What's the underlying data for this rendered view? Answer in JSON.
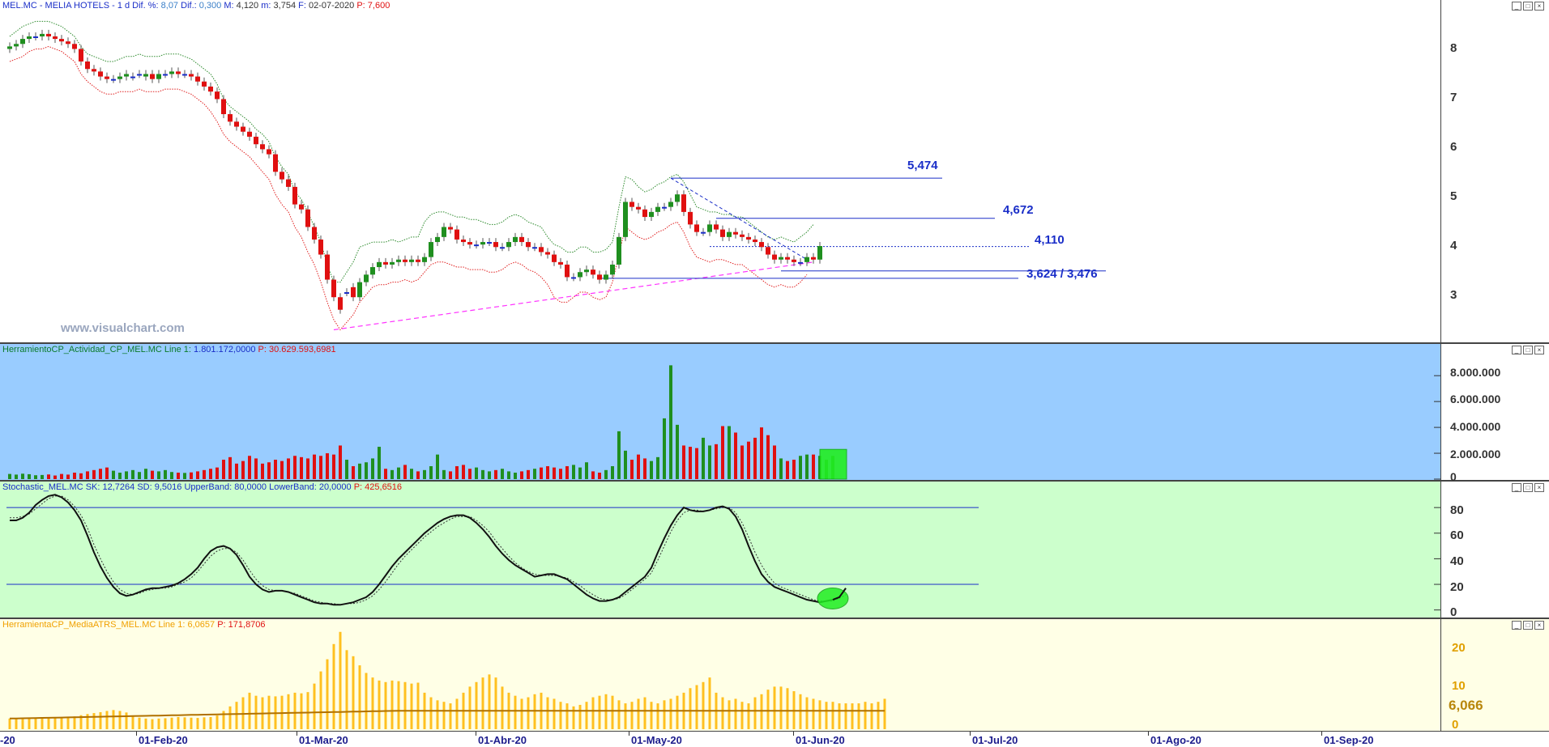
{
  "price_panel": {
    "header": {
      "symbol_text": "MEL.MC - MELIA HOTELS -",
      "period_text": "1 d",
      "dif_pct_label": "Dif. %:",
      "dif_pct_value": "8,07",
      "dif_label": "Dif.:",
      "dif_value": "0,300",
      "max_label": "M:",
      "max_value": "4,120",
      "min_label": "m:",
      "min_value": "3,754",
      "date_label": "F:",
      "date_value": "02-07-2020",
      "p_label": "P:",
      "p_value": "7,600"
    },
    "watermark": "www.visualchart.com",
    "annotations": {
      "resist1": "5,474",
      "resist2": "4,672",
      "pivot": "4,110",
      "support": "3,624 / 3,476"
    },
    "yticks": [
      "8",
      "7",
      "6",
      "5",
      "4",
      "3"
    ]
  },
  "volume_panel": {
    "header": {
      "name": "HerramientoCP_Actividad_CP_MEL.MC",
      "line_label": "Line 1:",
      "line_value": "1.801.172,0000",
      "p_label": "P:",
      "p_value": "30.629.593,6981"
    },
    "yticks": [
      "8.000.000",
      "6.000.000",
      "4.000.000",
      "2.000.000",
      "0"
    ]
  },
  "stoch_panel": {
    "header": {
      "name": "Stochastic_MEL.MC",
      "sk_label": "SK:",
      "sk_value": "12,7264",
      "sd_label": "SD:",
      "sd_value": "9,5016",
      "upper_label": "UpperBand:",
      "upper_value": "80,0000",
      "lower_label": "LowerBand:",
      "lower_value": "20,0000",
      "p_label": "P:",
      "p_value": "425,6516"
    },
    "yticks": [
      "80",
      "60",
      "40",
      "20",
      "0"
    ]
  },
  "atr_panel": {
    "header": {
      "name": "HerramientaCP_MediaATRS_MEL.MC",
      "line_label": "Line 1:",
      "line_value": "6,0657",
      "p_label": "P:",
      "p_value": "171,8706"
    },
    "yticks": [
      "20",
      "10",
      "0"
    ],
    "last_value": "6,066"
  },
  "x_axis": {
    "labels": [
      "-20",
      "01-Feb-20",
      "01-Mar-20",
      "01-Abr-20",
      "01-May-20",
      "01-Jun-20",
      "01-Jul-20",
      "01-Ago-20",
      "01-Sep-20"
    ]
  },
  "window_buttons": {
    "min": "_",
    "max": "□",
    "close": "×"
  },
  "colors": {
    "bull": "#1f8f1f",
    "bear": "#e01010",
    "doji": "#1a2ec8",
    "upper_band": "#2e8b2e",
    "lower_band": "#e02020",
    "trendline": "#ff33ff",
    "annotation": "#1a2ec8",
    "volume_bg": "#99ccff",
    "stoch_bg": "#ccffcc",
    "atr_bg": "#ffffe6",
    "atr_bar": "#ffc020"
  },
  "chart_data": [
    {
      "type": "candlestick",
      "title": "MEL.MC - MELIA HOTELS - 1 d",
      "x": [
        "02-Jan-20",
        "03-Jan-20",
        "06-Jan-20",
        "07-Jan-20",
        "08-Jan-20",
        "09-Jan-20",
        "10-Jan-20",
        "13-Jan-20",
        "14-Jan-20",
        "15-Jan-20",
        "16-Jan-20",
        "17-Jan-20",
        "20-Jan-20",
        "21-Jan-20",
        "22-Jan-20",
        "23-Jan-20",
        "24-Jan-20",
        "27-Jan-20",
        "28-Jan-20",
        "29-Jan-20",
        "30-Jan-20",
        "31-Jan-20",
        "03-Feb-20",
        "04-Feb-20",
        "05-Feb-20",
        "06-Feb-20",
        "07-Feb-20",
        "10-Feb-20",
        "11-Feb-20",
        "12-Feb-20",
        "13-Feb-20",
        "14-Feb-20",
        "17-Feb-20",
        "18-Feb-20",
        "19-Feb-20",
        "20-Feb-20",
        "21-Feb-20",
        "24-Feb-20",
        "25-Feb-20",
        "26-Feb-20",
        "27-Feb-20",
        "28-Feb-20",
        "02-Mar-20",
        "03-Mar-20",
        "04-Mar-20",
        "05-Mar-20",
        "06-Mar-20",
        "09-Mar-20",
        "10-Mar-20",
        "11-Mar-20",
        "12-Mar-20",
        "13-Mar-20",
        "16-Mar-20",
        "17-Mar-20",
        "18-Mar-20",
        "19-Mar-20",
        "20-Mar-20",
        "23-Mar-20",
        "24-Mar-20",
        "25-Mar-20",
        "26-Mar-20",
        "27-Mar-20",
        "30-Mar-20",
        "31-Mar-20",
        "01-Apr-20",
        "02-Apr-20",
        "03-Apr-20",
        "06-Apr-20",
        "07-Apr-20",
        "08-Apr-20",
        "09-Apr-20",
        "14-Apr-20",
        "15-Apr-20",
        "16-Apr-20",
        "17-Apr-20",
        "20-Apr-20",
        "21-Apr-20",
        "22-Apr-20",
        "23-Apr-20",
        "24-Apr-20",
        "27-Apr-20",
        "28-Apr-20",
        "29-Apr-20",
        "30-Apr-20",
        "04-May-20",
        "05-May-20",
        "06-May-20",
        "07-May-20",
        "08-May-20",
        "11-May-20",
        "12-May-20",
        "13-May-20",
        "14-May-20",
        "15-May-20",
        "18-May-20",
        "19-May-20",
        "20-May-20",
        "21-May-20",
        "22-May-20",
        "25-May-20",
        "26-May-20",
        "27-May-20",
        "28-May-20",
        "29-May-20",
        "01-Jun-20",
        "02-Jun-20",
        "03-Jun-20",
        "04-Jun-20",
        "05-Jun-20",
        "08-Jun-20",
        "09-Jun-20",
        "10-Jun-20",
        "11-Jun-20",
        "12-Jun-20",
        "15-Jun-20",
        "16-Jun-20",
        "17-Jun-20",
        "18-Jun-20",
        "19-Jun-20",
        "22-Jun-20",
        "23-Jun-20",
        "24-Jun-20",
        "25-Jun-20",
        "26-Jun-20",
        "29-Jun-20",
        "30-Jun-20",
        "01-Jul-20",
        "02-Jul-20"
      ],
      "open": [
        8.05,
        8.1,
        8.15,
        8.25,
        8.3,
        8.3,
        8.35,
        8.3,
        8.25,
        8.2,
        8.15,
        8.05,
        7.8,
        7.65,
        7.6,
        7.5,
        7.45,
        7.45,
        7.5,
        7.5,
        7.55,
        7.5,
        7.55,
        7.45,
        7.55,
        7.55,
        7.6,
        7.55,
        7.55,
        7.5,
        7.4,
        7.3,
        7.2,
        7.05,
        6.75,
        6.6,
        6.5,
        6.4,
        6.3,
        6.15,
        6.05,
        5.95,
        5.6,
        5.45,
        5.3,
        4.95,
        4.85,
        4.5,
        4.25,
        3.95,
        3.45,
        3.1,
        3.2,
        3.3,
        3.1,
        3.4,
        3.55,
        3.7,
        3.8,
        3.75,
        3.8,
        3.85,
        3.8,
        3.85,
        3.8,
        3.9,
        4.2,
        4.3,
        4.5,
        4.45,
        4.25,
        4.2,
        4.15,
        4.15,
        4.2,
        4.2,
        4.1,
        4.1,
        4.2,
        4.3,
        4.2,
        4.1,
        4.1,
        4.0,
        3.95,
        3.8,
        3.75,
        3.5,
        3.5,
        3.6,
        3.65,
        3.55,
        3.45,
        3.55,
        3.75,
        4.3,
        5.0,
        4.9,
        4.85,
        4.7,
        4.8,
        4.9,
        4.9,
        5.0,
        5.15,
        4.8,
        4.55,
        4.4,
        4.4,
        4.55,
        4.45,
        4.3,
        4.4,
        4.35,
        4.3,
        4.25,
        4.2,
        4.1,
        3.95,
        3.85,
        3.9,
        3.85,
        3.8,
        3.8,
        3.9,
        3.85
      ],
      "close": [
        8.1,
        8.15,
        8.25,
        8.3,
        8.3,
        8.35,
        8.3,
        8.25,
        8.2,
        8.15,
        8.05,
        7.8,
        7.65,
        7.6,
        7.5,
        7.45,
        7.45,
        7.5,
        7.55,
        7.5,
        7.55,
        7.55,
        7.45,
        7.55,
        7.55,
        7.6,
        7.55,
        7.55,
        7.5,
        7.4,
        7.3,
        7.2,
        7.05,
        6.75,
        6.6,
        6.5,
        6.4,
        6.3,
        6.15,
        6.05,
        5.95,
        5.6,
        5.45,
        5.3,
        4.95,
        4.85,
        4.5,
        4.25,
        3.95,
        3.45,
        3.1,
        2.85,
        3.2,
        3.1,
        3.4,
        3.55,
        3.7,
        3.8,
        3.75,
        3.8,
        3.85,
        3.8,
        3.85,
        3.8,
        3.9,
        4.2,
        4.3,
        4.5,
        4.45,
        4.25,
        4.2,
        4.15,
        4.15,
        4.2,
        4.2,
        4.1,
        4.1,
        4.2,
        4.3,
        4.2,
        4.1,
        4.1,
        4.0,
        3.95,
        3.8,
        3.75,
        3.5,
        3.5,
        3.6,
        3.65,
        3.55,
        3.45,
        3.55,
        3.75,
        4.3,
        5.0,
        4.9,
        4.85,
        4.7,
        4.8,
        4.9,
        4.9,
        5.0,
        5.15,
        4.8,
        4.55,
        4.4,
        4.4,
        4.55,
        4.45,
        4.3,
        4.4,
        4.35,
        4.3,
        4.25,
        4.2,
        4.1,
        3.95,
        3.85,
        3.9,
        3.85,
        3.8,
        3.8,
        3.9,
        3.85,
        4.12
      ],
      "upper_band": [
        8.3,
        8.4,
        8.5,
        8.55,
        8.6,
        8.6,
        8.6,
        8.55,
        8.5,
        8.4,
        8.3,
        8.1,
        7.95,
        7.9,
        7.85,
        7.8,
        7.8,
        7.85,
        7.9,
        7.9,
        7.95,
        7.9,
        7.9,
        7.9,
        7.95,
        7.95,
        7.95,
        7.9,
        7.85,
        7.75,
        7.65,
        7.55,
        7.35,
        7.05,
        6.9,
        6.8,
        6.7,
        6.6,
        6.45,
        6.35,
        6.2,
        5.9,
        5.7,
        5.55,
        5.2,
        5.05,
        4.8,
        4.5,
        4.2,
        3.75,
        3.4,
        3.4,
        3.6,
        3.8,
        4.1,
        4.15,
        4.2,
        4.2,
        4.2,
        4.25,
        4.2,
        4.25,
        4.3,
        4.3,
        4.6,
        4.75,
        4.8,
        4.8,
        4.75,
        4.7,
        4.7,
        4.65,
        4.65,
        4.6,
        4.55,
        4.55,
        4.6,
        4.7,
        4.75,
        4.7,
        4.6,
        4.55,
        4.5,
        4.3,
        4.15,
        4.1,
        4.0,
        4.0,
        4.1,
        4.1,
        4.0,
        4.0,
        4.05,
        4.2,
        4.9,
        5.5,
        5.45,
        5.3,
        5.2,
        5.25,
        5.35,
        5.4,
        5.5,
        5.55,
        5.4,
        5.15,
        4.9,
        4.85,
        4.8,
        4.8,
        4.75,
        4.75,
        4.7,
        4.7,
        4.6,
        4.5,
        4.4,
        4.3,
        4.25,
        4.3,
        4.25,
        4.2,
        4.3,
        4.4,
        4.55
      ],
      "lower_band": [
        7.8,
        7.85,
        7.9,
        8.0,
        8.05,
        8.05,
        8.1,
        8.05,
        8.0,
        7.9,
        7.8,
        7.55,
        7.4,
        7.3,
        7.2,
        7.15,
        7.15,
        7.2,
        7.2,
        7.2,
        7.25,
        7.2,
        7.2,
        7.2,
        7.25,
        7.25,
        7.25,
        7.2,
        7.15,
        7.05,
        6.95,
        6.8,
        6.6,
        6.35,
        6.2,
        6.1,
        6.0,
        5.9,
        5.75,
        5.6,
        5.45,
        5.15,
        4.95,
        4.8,
        4.5,
        4.3,
        4.0,
        3.75,
        3.4,
        3.0,
        2.65,
        2.45,
        2.6,
        2.75,
        3.0,
        3.15,
        3.3,
        3.35,
        3.35,
        3.4,
        3.4,
        3.45,
        3.4,
        3.45,
        3.6,
        3.75,
        3.8,
        3.8,
        3.75,
        3.7,
        3.7,
        3.65,
        3.65,
        3.65,
        3.6,
        3.6,
        3.65,
        3.75,
        3.8,
        3.75,
        3.65,
        3.6,
        3.5,
        3.35,
        3.1,
        3.0,
        3.0,
        3.1,
        3.2,
        3.2,
        3.1,
        3.05,
        3.1,
        3.4,
        3.95,
        4.5,
        4.4,
        4.3,
        4.25,
        4.3,
        4.4,
        4.45,
        4.55,
        4.6,
        4.4,
        4.1,
        3.9,
        3.85,
        3.8,
        3.85,
        3.85,
        3.8,
        3.75,
        3.75,
        3.65,
        3.55,
        3.45,
        3.35,
        3.3,
        3.35,
        3.3,
        3.3,
        3.4,
        3.55
      ],
      "ylim": [
        2.2,
        8.8
      ]
    },
    {
      "type": "bar",
      "name": "HerramientoCP_Actividad_CP_MEL.MC",
      "values": [
        400000,
        350000,
        420000,
        380000,
        300000,
        320000,
        360000,
        280000,
        400000,
        350000,
        500000,
        450000,
        600000,
        700000,
        800000,
        900000,
        650000,
        500000,
        600000,
        700000,
        550000,
        800000,
        650000,
        600000,
        700000,
        550000,
        500000,
        480000,
        520000,
        600000,
        700000,
        800000,
        900000,
        1500000,
        1700000,
        1200000,
        1400000,
        1800000,
        1600000,
        1200000,
        1300000,
        1500000,
        1400000,
        1600000,
        1800000,
        1700000,
        1600000,
        1900000,
        1800000,
        2000000,
        1900000,
        2600000,
        1500000,
        1000000,
        1200000,
        1300000,
        1600000,
        2500000,
        800000,
        700000,
        900000,
        1100000,
        800000,
        600000,
        700000,
        1000000,
        1900000,
        700000,
        600000,
        1000000,
        1100000,
        800000,
        900000,
        700000,
        600000,
        700000,
        800000,
        600000,
        500000,
        600000,
        700000,
        800000,
        900000,
        1000000,
        900000,
        800000,
        1000000,
        1100000,
        900000,
        1300000,
        600000,
        500000,
        700000,
        1000000,
        3700000,
        2200000,
        1500000,
        1900000,
        1600000,
        1400000,
        1700000,
        4700000,
        8800000,
        4200000,
        2600000,
        2500000,
        2400000,
        3200000,
        2600000,
        2700000,
        4100000,
        4100000,
        3600000,
        2600000,
        2900000,
        3200000,
        4000000,
        3400000,
        2600000,
        1600000,
        1400000,
        1500000,
        1800000,
        1900000,
        1900000,
        1800000,
        1500000,
        1800000
      ],
      "ylim": [
        0,
        9200000
      ],
      "yticks": [
        0,
        2000000,
        4000000,
        6000000,
        8000000
      ]
    },
    {
      "type": "line",
      "name": "Stochastic_MEL.MC",
      "series_sk": [
        70,
        70,
        72,
        76,
        82,
        86,
        89,
        90,
        88,
        84,
        78,
        70,
        58,
        45,
        34,
        25,
        18,
        13,
        11,
        12,
        14,
        16,
        17,
        17,
        18,
        19,
        21,
        24,
        28,
        33,
        40,
        46,
        49,
        50,
        48,
        43,
        35,
        26,
        20,
        16,
        14,
        15,
        15,
        14,
        12,
        10,
        8,
        6,
        5,
        5,
        4,
        4,
        5,
        6,
        8,
        10,
        14,
        20,
        27,
        34,
        40,
        45,
        50,
        55,
        60,
        64,
        68,
        71,
        73,
        74,
        74,
        72,
        68,
        63,
        57,
        50,
        44,
        39,
        35,
        32,
        29,
        26,
        27,
        28,
        28,
        26,
        24,
        20,
        16,
        12,
        9,
        7,
        7,
        8,
        10,
        14,
        18,
        22,
        26,
        33,
        45,
        56,
        66,
        74,
        80,
        78,
        77,
        77,
        78,
        80,
        81,
        79,
        73,
        63,
        50,
        38,
        28,
        22,
        18,
        16,
        14,
        12,
        10,
        8,
        7,
        6,
        7,
        8,
        10,
        17
      ],
      "series_sd": [
        72,
        72,
        73,
        75,
        79,
        83,
        87,
        89,
        89,
        86,
        81,
        74,
        64,
        51,
        40,
        30,
        22,
        16,
        13,
        12,
        13,
        15,
        16,
        17,
        17,
        18,
        20,
        22,
        25,
        30,
        36,
        42,
        46,
        48,
        48,
        45,
        39,
        31,
        24,
        19,
        16,
        15,
        15,
        14,
        13,
        11,
        9,
        7,
        6,
        5,
        5,
        4,
        5,
        5,
        6,
        8,
        11,
        16,
        22,
        29,
        36,
        42,
        47,
        52,
        57,
        61,
        65,
        68,
        71,
        73,
        73,
        73,
        70,
        66,
        61,
        54,
        48,
        42,
        37,
        33,
        30,
        28,
        27,
        27,
        27,
        26,
        25,
        22,
        19,
        15,
        12,
        9,
        8,
        8,
        9,
        12,
        16,
        20,
        24,
        29,
        39,
        50,
        61,
        70,
        76,
        78,
        78,
        77,
        78,
        79,
        80,
        80,
        76,
        68,
        57,
        45,
        35,
        27,
        21,
        18,
        16,
        14,
        12,
        10,
        8,
        7,
        7,
        7,
        9,
        12
      ],
      "upper_band": 80,
      "lower_band": 20,
      "ylim": [
        -4,
        94
      ],
      "yticks": [
        0,
        20,
        40,
        60,
        80
      ]
    },
    {
      "type": "bar",
      "name": "HerramientaCP_MediaATRS_MEL.MC",
      "values": [
        3.5,
        3.5,
        3.4,
        3.5,
        3.6,
        3.5,
        3.7,
        3.6,
        3.8,
        3.9,
        4.2,
        4.6,
        5.0,
        5.3,
        5.6,
        6.0,
        6.3,
        6.0,
        5.5,
        4.5,
        3.8,
        3.5,
        3.3,
        3.5,
        3.6,
        3.8,
        4.0,
        3.9,
        3.8,
        3.7,
        3.9,
        4.0,
        4.5,
        6.0,
        7.5,
        9.0,
        10.5,
        12.0,
        11.0,
        10.5,
        11.0,
        10.8,
        11.0,
        11.5,
        12.0,
        11.8,
        12.2,
        15.0,
        19.0,
        23.0,
        28.0,
        32.0,
        26.0,
        24.0,
        21.0,
        18.5,
        17.0,
        16.0,
        15.5,
        16.0,
        15.8,
        15.5,
        15.0,
        15.3,
        12.0,
        10.5,
        9.5,
        9.0,
        8.5,
        10.0,
        12.0,
        14.0,
        15.5,
        17.0,
        18.0,
        17.0,
        14.0,
        12.0,
        11.0,
        10.0,
        10.5,
        11.5,
        12.0,
        10.5,
        10.0,
        9.0,
        8.5,
        7.5,
        8.0,
        9.0,
        10.5,
        11.0,
        11.5,
        11.0,
        9.5,
        8.5,
        9.0,
        10.0,
        10.5,
        9.0,
        8.5,
        9.5,
        10.0,
        11.0,
        12.0,
        13.5,
        14.5,
        15.5,
        17.0,
        12.0,
        10.5,
        9.5,
        10.0,
        9.0,
        8.5,
        10.5,
        11.5,
        13.0,
        14.0,
        14.0,
        13.5,
        12.5,
        11.5,
        10.5,
        10.0,
        9.5,
        9.0,
        9.0,
        8.5,
        8.5,
        8.5,
        8.5,
        9.0,
        8.5,
        9.0,
        10.0
      ],
      "avg_line": 6.066,
      "ylim": [
        0,
        25
      ],
      "yticks": [
        0,
        10,
        20
      ]
    }
  ]
}
